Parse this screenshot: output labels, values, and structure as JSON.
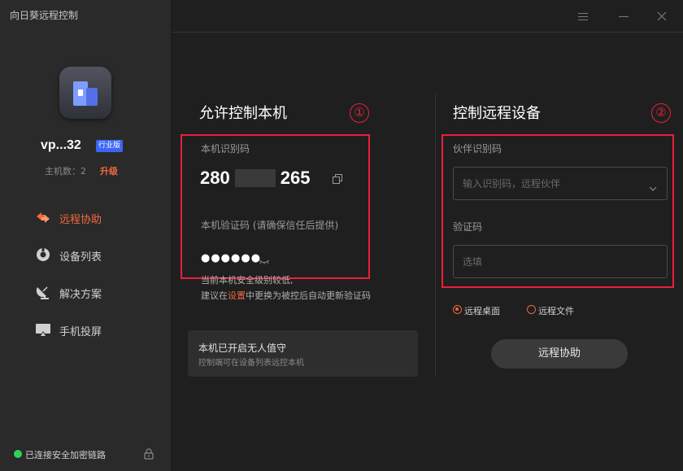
{
  "app": {
    "title": "向日葵远程控制"
  },
  "sidebar": {
    "username": "vp...32",
    "edition": "行业版",
    "host_count": "主机数：2",
    "upgrade": "升级",
    "nav": [
      {
        "label": "远程协助",
        "icon": "remote-assist-icon",
        "active": true
      },
      {
        "label": "设备列表",
        "icon": "device-list-icon",
        "active": false
      },
      {
        "label": "解决方案",
        "icon": "solution-icon",
        "active": false
      },
      {
        "label": "手机投屏",
        "icon": "screen-cast-icon",
        "active": false
      }
    ],
    "status": "已连接安全加密链路"
  },
  "left_panel": {
    "title": "允许控制本机",
    "device_code_label": "本机识别码",
    "device_code_prefix": "280",
    "device_code_suffix": "265",
    "verify_label": "本机验证码 (请确保信任后提供)",
    "verify_code": "●●●●●●",
    "hint_line1": "当前本机安全级别较低,",
    "hint_line2_pre": "建议在",
    "hint_line2_link": "设置",
    "hint_line2_post": "中更换为被控后自动更新验证码",
    "unattended_title": "本机已开启无人值守",
    "unattended_sub": "控制端可在设备列表远控本机"
  },
  "right_panel": {
    "title": "控制远程设备",
    "partner_label": "伙伴识别码",
    "partner_placeholder": "输入识别码，远程伙伴",
    "verify_label": "验证码",
    "verify_placeholder": "选填",
    "radio_desktop": "远程桌面",
    "radio_file": "远程文件",
    "assist_button": "远程协助"
  },
  "annotations": {
    "one": "①",
    "two": "②",
    "color": "#e8203a"
  },
  "colors": {
    "accent": "#f0683d",
    "badge": "#3b66f5",
    "status_ok": "#2ed25a"
  }
}
